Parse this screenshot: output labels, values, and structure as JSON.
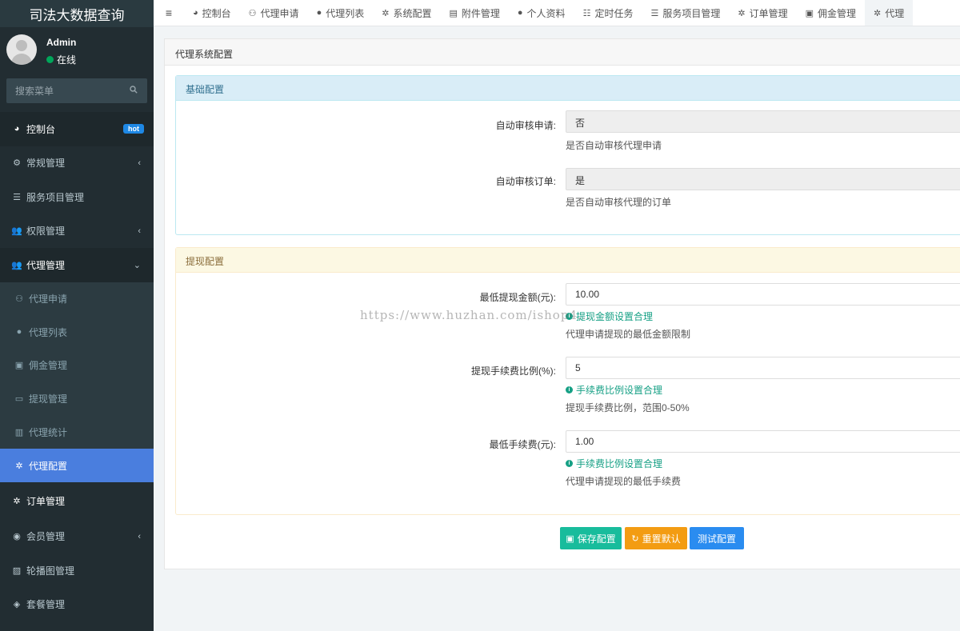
{
  "brand": "司法大数据查询",
  "user": {
    "name": "Admin",
    "status": "在线"
  },
  "search": {
    "placeholder": "搜索菜单"
  },
  "menu": [
    {
      "label": "控制台",
      "icon": "dashboard-icon",
      "badge": "hot"
    },
    {
      "label": "常规管理",
      "icon": "cogs-icon"
    },
    {
      "label": "服务项目管理",
      "icon": "list-icon"
    },
    {
      "label": "权限管理",
      "icon": "group-icon"
    },
    {
      "label": "代理管理",
      "icon": "group-icon"
    },
    {
      "label": "代理申请",
      "icon": "user-plus-icon"
    },
    {
      "label": "代理列表",
      "icon": "user-icon"
    },
    {
      "label": "佣金管理",
      "icon": "money-icon"
    },
    {
      "label": "提现管理",
      "icon": "credit-card-icon"
    },
    {
      "label": "代理统计",
      "icon": "bar-chart-icon"
    },
    {
      "label": "代理配置",
      "icon": "gear-icon"
    },
    {
      "label": "订单管理",
      "icon": "gear-icon"
    },
    {
      "label": "会员管理",
      "icon": "user-circle-icon"
    },
    {
      "label": "轮播图管理",
      "icon": "image-icon"
    },
    {
      "label": "套餐管理",
      "icon": "cube-icon"
    }
  ],
  "tabs": [
    {
      "label": "控制台",
      "icon": "dashboard-icon"
    },
    {
      "label": "代理申请",
      "icon": "user-plus-icon"
    },
    {
      "label": "代理列表",
      "icon": "user-icon"
    },
    {
      "label": "系统配置",
      "icon": "gear-icon"
    },
    {
      "label": "附件管理",
      "icon": "file-icon"
    },
    {
      "label": "个人资料",
      "icon": "user-icon"
    },
    {
      "label": "定时任务",
      "icon": "tasks-icon"
    },
    {
      "label": "服务项目管理",
      "icon": "list-icon"
    },
    {
      "label": "订单管理",
      "icon": "gear-icon"
    },
    {
      "label": "佣金管理",
      "icon": "money-icon"
    },
    {
      "label": "代理",
      "icon": "gear-icon"
    }
  ],
  "panel": {
    "title": "代理系统配置",
    "basic": {
      "title": "基础配置",
      "fields": [
        {
          "label": "自动审核申请:",
          "value": "否",
          "help": "是否自动审核代理申请"
        },
        {
          "label": "自动审核订单:",
          "value": "是",
          "help": "是否自动审核代理的订单"
        }
      ]
    },
    "withdraw": {
      "title": "提现配置",
      "fields": [
        {
          "label": "最低提现金额(元):",
          "value": "10.00",
          "ok": "提现金额设置合理",
          "help": "代理申请提现的最低金额限制"
        },
        {
          "label": "提现手续费比例(%):",
          "value": "5",
          "ok": "手续费比例设置合理",
          "help": "提现手续费比例，范围0-50%"
        },
        {
          "label": "最低手续费(元):",
          "value": "1.00",
          "ok": "手续费比例设置合理",
          "help": "代理申请提现的最低手续费"
        }
      ]
    },
    "buttons": {
      "save": "保存配置",
      "reset": "重置默认",
      "test": "测试配置"
    }
  },
  "watermark": "https://www.huzhan.com/ishop4...",
  "colors": {
    "sidebar": "#222d32",
    "active": "#4a7ede",
    "save": "#18bc9c",
    "reset": "#f39c12",
    "test": "#2a8cf0"
  }
}
